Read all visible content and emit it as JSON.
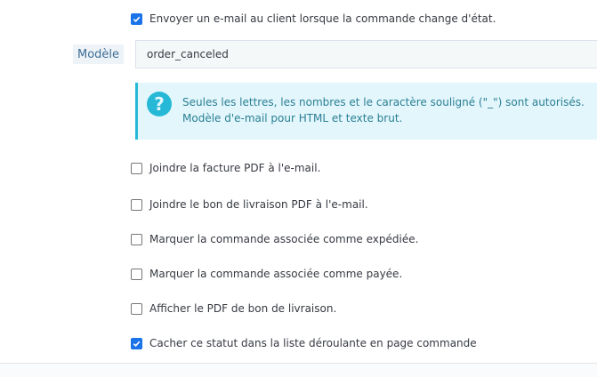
{
  "email_option": {
    "label": "Envoyer un e-mail au client lorsque la commande change d'état.",
    "checked": true
  },
  "template": {
    "label": "Modèle",
    "value": "order_canceled"
  },
  "help": {
    "icon": "question-circle-icon",
    "line1": "Seules les lettres, les nombres et le caractère souligné (\"_\") sont autorisés.",
    "line2": "Modèle d'e-mail pour HTML et texte brut."
  },
  "options": [
    {
      "label": "Joindre la facture PDF à l'e-mail.",
      "checked": false
    },
    {
      "label": "Joindre le bon de livraison PDF à l'e-mail.",
      "checked": false
    },
    {
      "label": "Marquer la commande associée comme expédiée.",
      "checked": false
    },
    {
      "label": "Marquer la commande associée comme payée.",
      "checked": false
    },
    {
      "label": "Afficher le PDF de bon de livraison.",
      "checked": false
    },
    {
      "label": "Cacher ce statut dans la liste déroulante en page commande",
      "checked": true
    }
  ],
  "colors": {
    "accent": "#1a73e8",
    "info": "#25b9d7",
    "info_bg": "#e2f6fb"
  }
}
